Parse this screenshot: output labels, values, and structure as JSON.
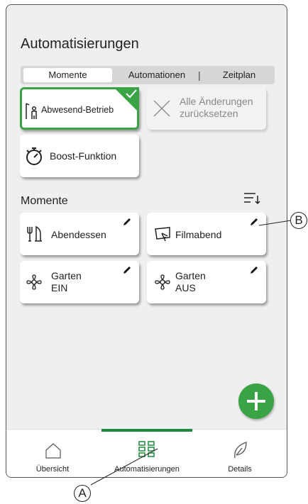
{
  "screen": {
    "title": "Automatisierungen",
    "section_title": "Momente"
  },
  "tabs": [
    {
      "label": "Momente",
      "active": true
    },
    {
      "label": "Automationen",
      "active": false
    },
    {
      "label": "Zeitplan",
      "active": false
    }
  ],
  "tab_separator": "|",
  "quick_tiles": {
    "away": {
      "label": "Abwesend-Betrieb",
      "selected": true,
      "icon": "away-person-door-icon"
    },
    "reset": {
      "line1": "Alle Änderungen",
      "line2": "zurücksetzen",
      "disabled": true,
      "icon": "close-x-icon"
    },
    "boost": {
      "label": "Boost-Funktion",
      "icon": "stopwatch-icon"
    }
  },
  "moments": [
    {
      "label": "Abendessen",
      "icon": "cutlery-icon"
    },
    {
      "label": "Filmabend",
      "icon": "tv-hand-icon"
    },
    {
      "line1": "Garten",
      "line2": "EIN",
      "icon": "flower-icon"
    },
    {
      "line1": "Garten",
      "line2": "AUS",
      "icon": "flower-icon"
    }
  ],
  "nav": [
    {
      "label": "Übersicht",
      "icon": "home-icon",
      "active": false
    },
    {
      "label": "Automatisierungen",
      "icon": "grid-icon",
      "active": true
    },
    {
      "label": "Details",
      "icon": "leaf-icon",
      "active": false
    }
  ],
  "callouts": {
    "a": "A",
    "b": "B"
  },
  "colors": {
    "accent": "#3aa346",
    "nav_indicator": "#1b8a3a",
    "background": "#efefef"
  }
}
